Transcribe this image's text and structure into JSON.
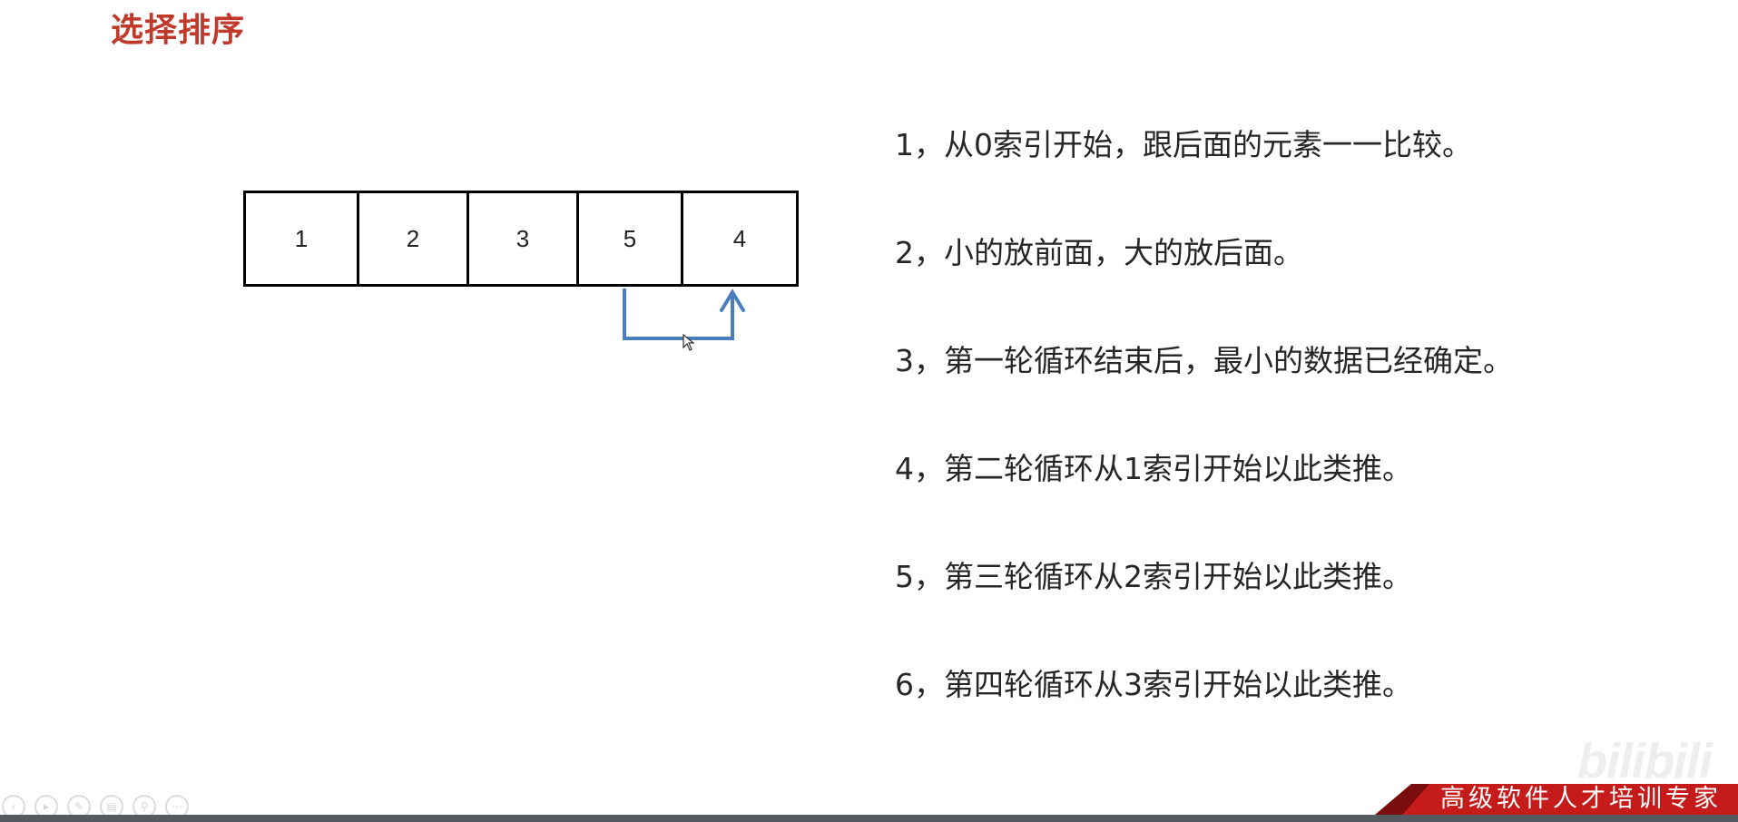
{
  "slide": {
    "title": "选择排序"
  },
  "array": {
    "cells": [
      "1",
      "2",
      "3",
      "5",
      "4"
    ]
  },
  "steps": [
    "1，从0索引开始，跟后面的元素一一比较。",
    "2，小的放前面，大的放后面。",
    "3，第一轮循环结束后，最小的数据已经确定。",
    "4，第二轮循环从1索引开始以此类推。",
    "5，第三轮循环从2索引开始以此类推。",
    "6，第四轮循环从3索引开始以此类推。"
  ],
  "footer": {
    "banner_text": "高级软件人才培训专家",
    "watermark": "bilibili"
  },
  "colors": {
    "title": "#c0392b",
    "arrow": "#4a7ebf",
    "banner": "#c61b1b"
  },
  "icons": [
    "prev-icon",
    "play-icon",
    "pen-icon",
    "copy-icon",
    "zoom-icon",
    "more-icon"
  ]
}
